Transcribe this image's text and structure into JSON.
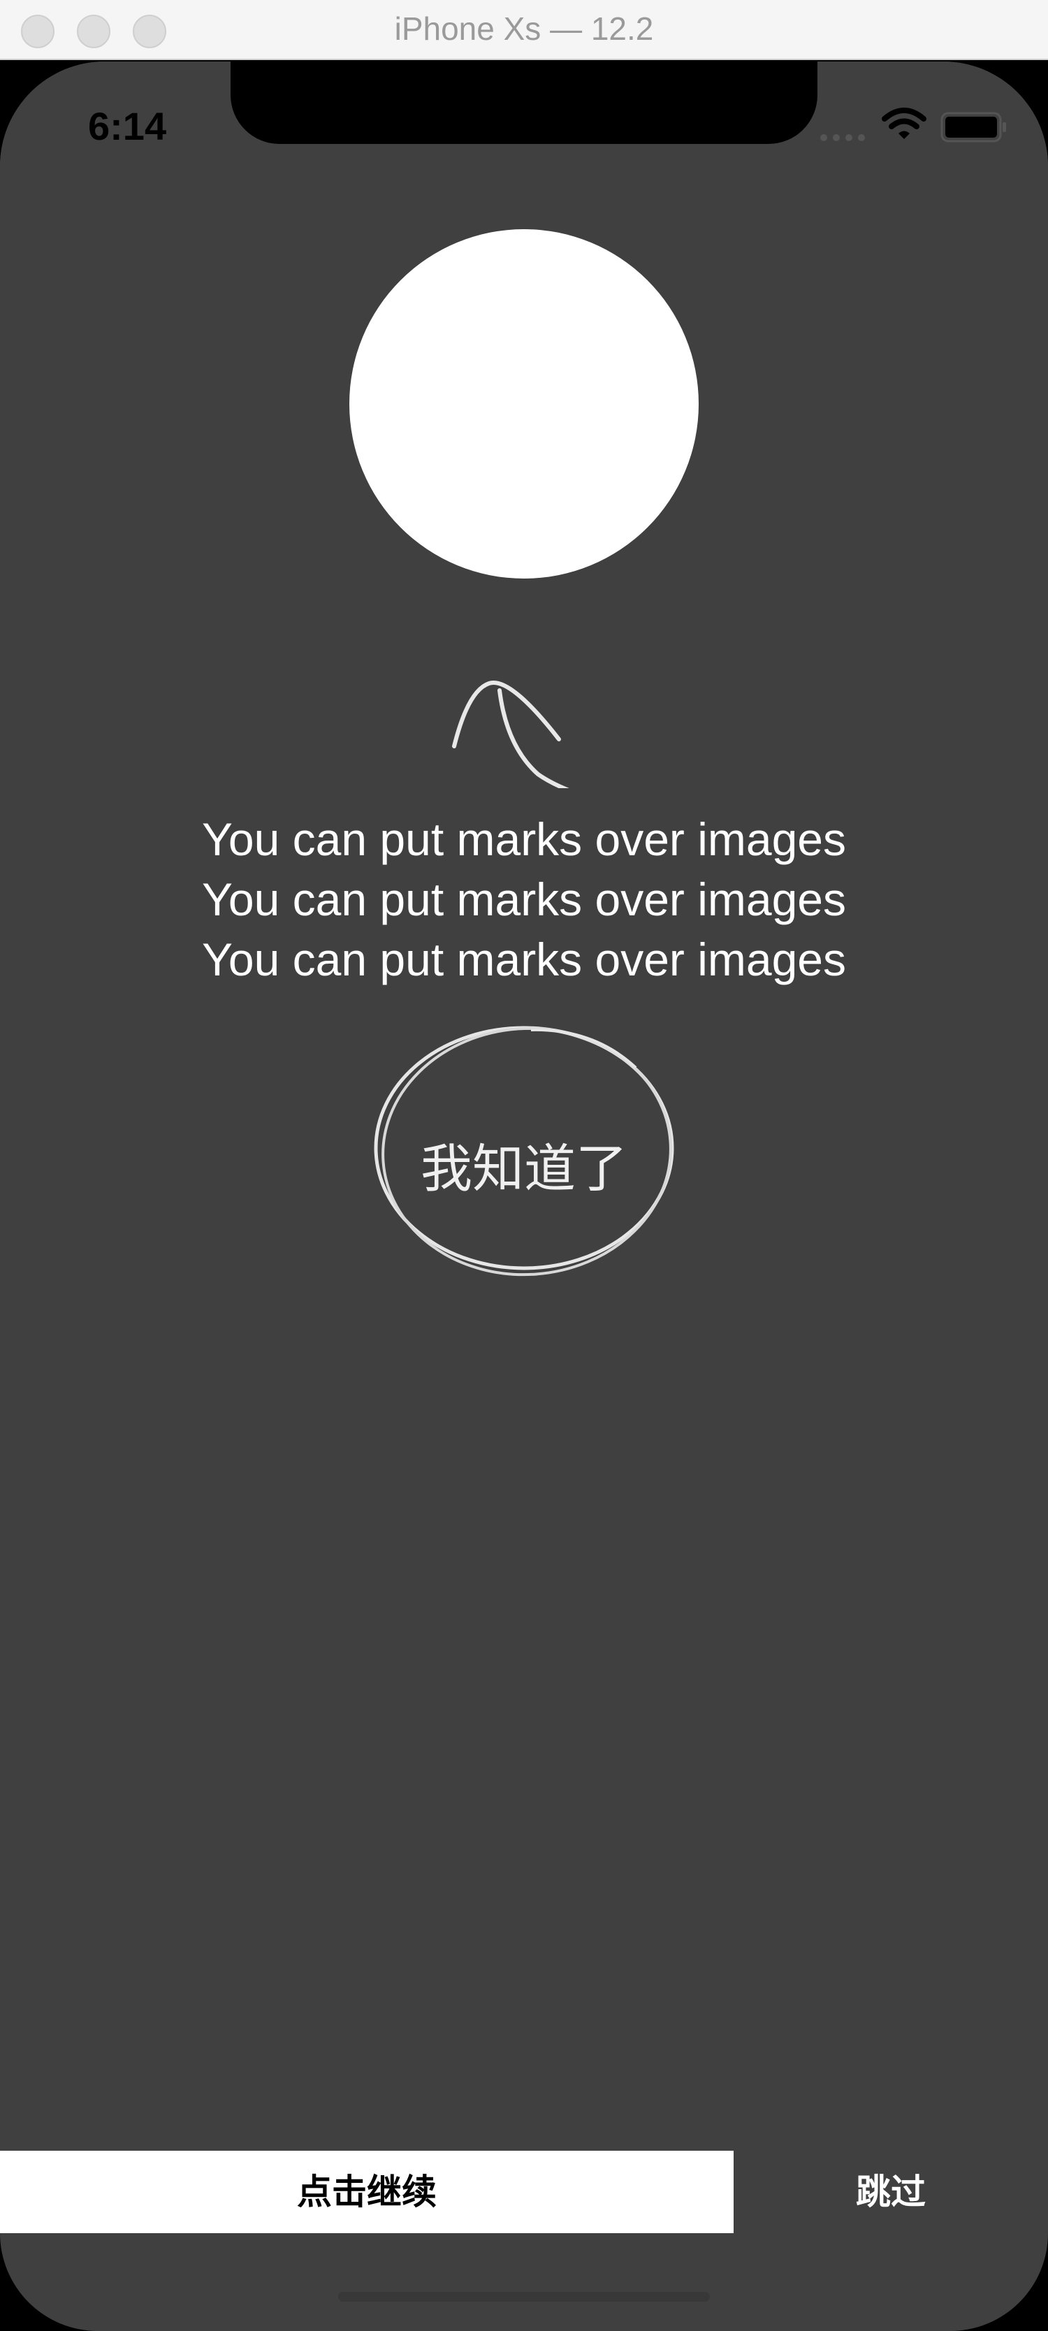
{
  "window": {
    "title": "iPhone Xs — 12.2"
  },
  "status_bar": {
    "time": "6:14",
    "icons": [
      "signal-dots-icon",
      "wifi-icon",
      "battery-icon"
    ]
  },
  "guide": {
    "message_lines": [
      "You can put marks over images",
      "You can put marks over images",
      "You can put marks over images"
    ],
    "got_it_label": "我知道了"
  },
  "bottom_bar": {
    "continue_label": "点击继续",
    "skip_label": "跳过"
  },
  "colors": {
    "overlay": "#404040",
    "highlight": "#ffffff",
    "text": "#ffffff"
  }
}
